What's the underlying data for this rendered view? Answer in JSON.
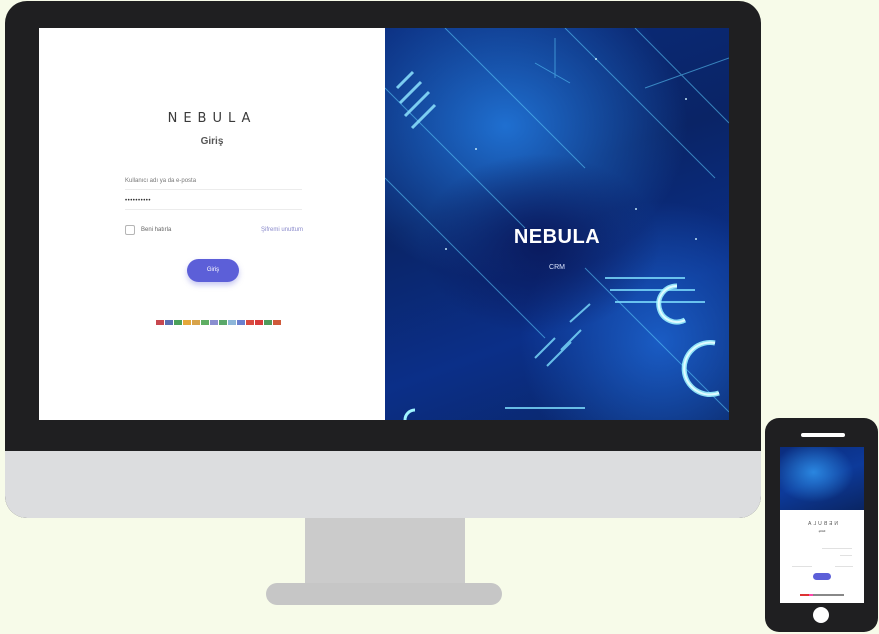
{
  "login": {
    "brand": "NEBULA",
    "title": "Giriş",
    "username_placeholder": "Kullanıcı adı ya da e-posta",
    "password_value": "••••••••••",
    "remember_label": "Beni hatırla",
    "forgot_label": "Şifremi unuttum",
    "submit_label": "Giriş",
    "flags": [
      {
        "name": "us",
        "color": "#c7474f"
      },
      {
        "name": "gb",
        "color": "#5a6fb3"
      },
      {
        "name": "it",
        "color": "#4aa05a"
      },
      {
        "name": "es",
        "color": "#e5a83a"
      },
      {
        "name": "de",
        "color": "#d8a34a"
      },
      {
        "name": "ie",
        "color": "#5fae63"
      },
      {
        "name": "fr",
        "color": "#8a8fd0"
      },
      {
        "name": "br",
        "color": "#5aa86a"
      },
      {
        "name": "ar",
        "color": "#8db6d9"
      },
      {
        "name": "ru",
        "color": "#6a7fcf"
      },
      {
        "name": "cn",
        "color": "#d94a3f"
      },
      {
        "name": "tr",
        "color": "#d83b3b"
      },
      {
        "name": "sa",
        "color": "#4f9a5b"
      },
      {
        "name": "pt",
        "color": "#cf5a3a"
      }
    ]
  },
  "hero": {
    "brand": "NEBULA",
    "subtitle": "CRM"
  },
  "phone": {
    "brand": "NEBULA",
    "title": "Giriş"
  },
  "colors": {
    "background": "#f7fbe9",
    "accent": "#5c5fd8",
    "hero_blue": "#0b2c7d",
    "device_frame": "#1f1f21"
  }
}
